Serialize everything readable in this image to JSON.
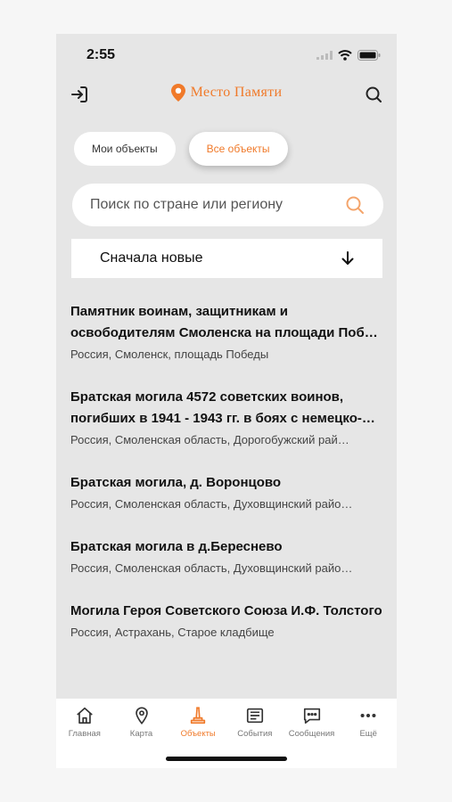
{
  "colors": {
    "accent": "#f07a2a",
    "background": "#e6e6e6",
    "icon": "#333333"
  },
  "status_bar": {
    "time": "2:55",
    "icons": [
      "cellular-icon",
      "wifi-icon",
      "battery-icon"
    ]
  },
  "header": {
    "brand": "Место Памяти",
    "left_icon": "login-icon",
    "right_icon": "search-icon",
    "brand_icon": "location-pin-icon"
  },
  "segments": {
    "mine": "Мои объекты",
    "all": "Все объекты",
    "active": "all"
  },
  "search": {
    "placeholder": "Поиск по стране или региону"
  },
  "sort": {
    "label": "Сначала новые"
  },
  "items": [
    {
      "title_line1": "Памятник воинам, защитникам и",
      "title_line2": "освободителям Смоленска на площади Побе…",
      "subtitle": "Россия, Смоленск, площадь Победы"
    },
    {
      "title_line1": "Братская могила 4572 советских воинов,",
      "title_line2": "погибших  в 1941 - 1943 гг. в боях с немецко-…",
      "subtitle": "Россия, Смоленская область, Дорогобужский рай…"
    },
    {
      "title_line1": "Братская могила, д. Воронцово",
      "subtitle": "Россия, Смоленская область, Духовщинский райо…"
    },
    {
      "title_line1": "Братская могила в д.Береснево",
      "subtitle": "Россия, Смоленская область, Духовщинский райо…"
    },
    {
      "title_line1": "Могила Героя Советского Союза И.Ф. Толстого",
      "subtitle": "Россия, Астрахань, Старое кладбище"
    }
  ],
  "tabs": [
    {
      "label": "Главная",
      "icon": "home-icon"
    },
    {
      "label": "Карта",
      "icon": "map-pin-icon"
    },
    {
      "label": "Объекты",
      "icon": "monument-icon",
      "active": true
    },
    {
      "label": "События",
      "icon": "newspaper-icon"
    },
    {
      "label": "Сообщения",
      "icon": "message-icon"
    },
    {
      "label": "Ещё",
      "icon": "more-icon"
    }
  ]
}
